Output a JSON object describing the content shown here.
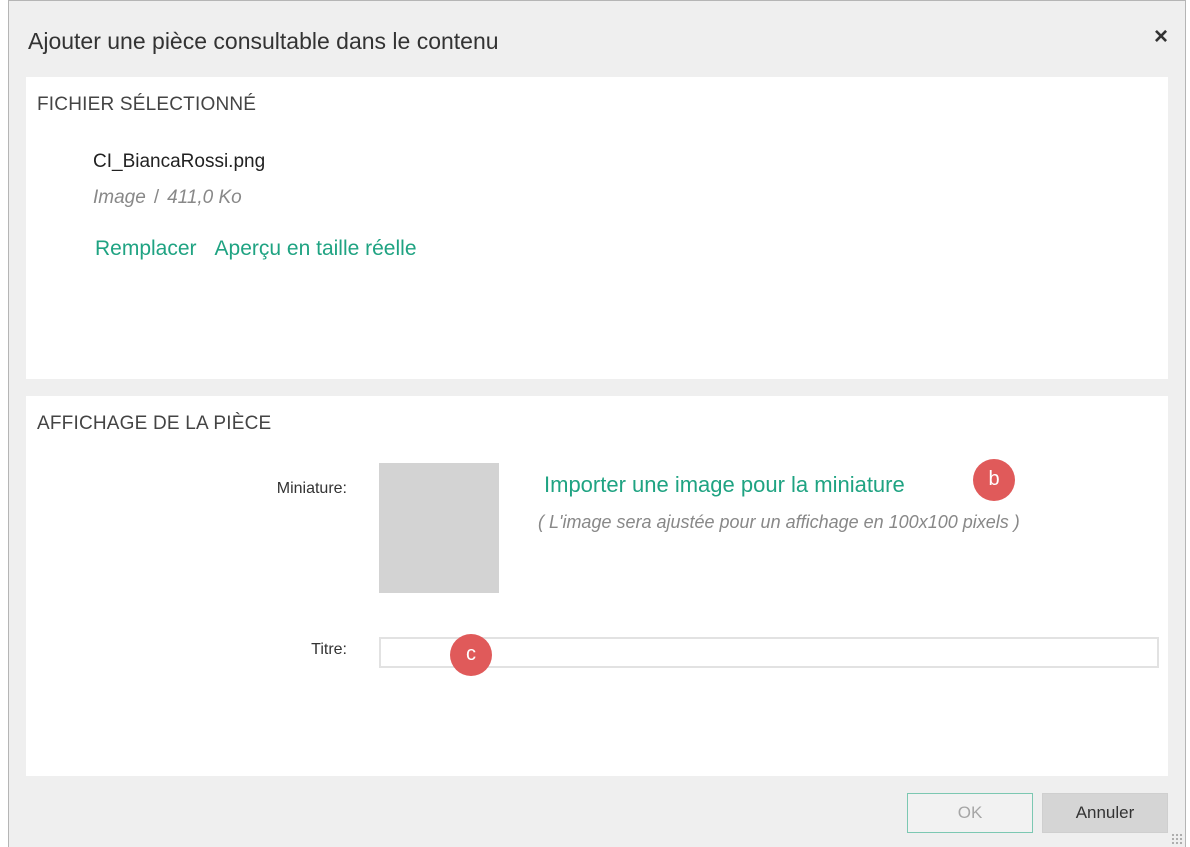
{
  "dialog": {
    "title": "Ajouter une pièce consultable dans le contenu",
    "close_icon": "×"
  },
  "file_section": {
    "header": "FICHIER SÉLECTIONNÉ",
    "file_name": "CI_BiancaRossi.png",
    "file_type": "Image",
    "separator": "/",
    "file_size": "411,0 Ko",
    "replace_link": "Remplacer",
    "preview_link": "Aperçu en taille réelle"
  },
  "display_section": {
    "header": "AFFICHAGE DE LA PIÈCE",
    "thumbnail_label": "Miniature:",
    "import_link": "Importer une image pour la miniature",
    "import_hint": "( L'image sera ajustée pour un affichage en 100x100 pixels )",
    "title_label": "Titre:",
    "title_value": ""
  },
  "markers": {
    "b": "b",
    "c": "c"
  },
  "footer": {
    "ok_label": "OK",
    "cancel_label": "Annuler"
  },
  "colors": {
    "accent_link": "#1fa382",
    "marker": "#e05a5a",
    "thumbnail_placeholder": "#d3d3d3"
  }
}
